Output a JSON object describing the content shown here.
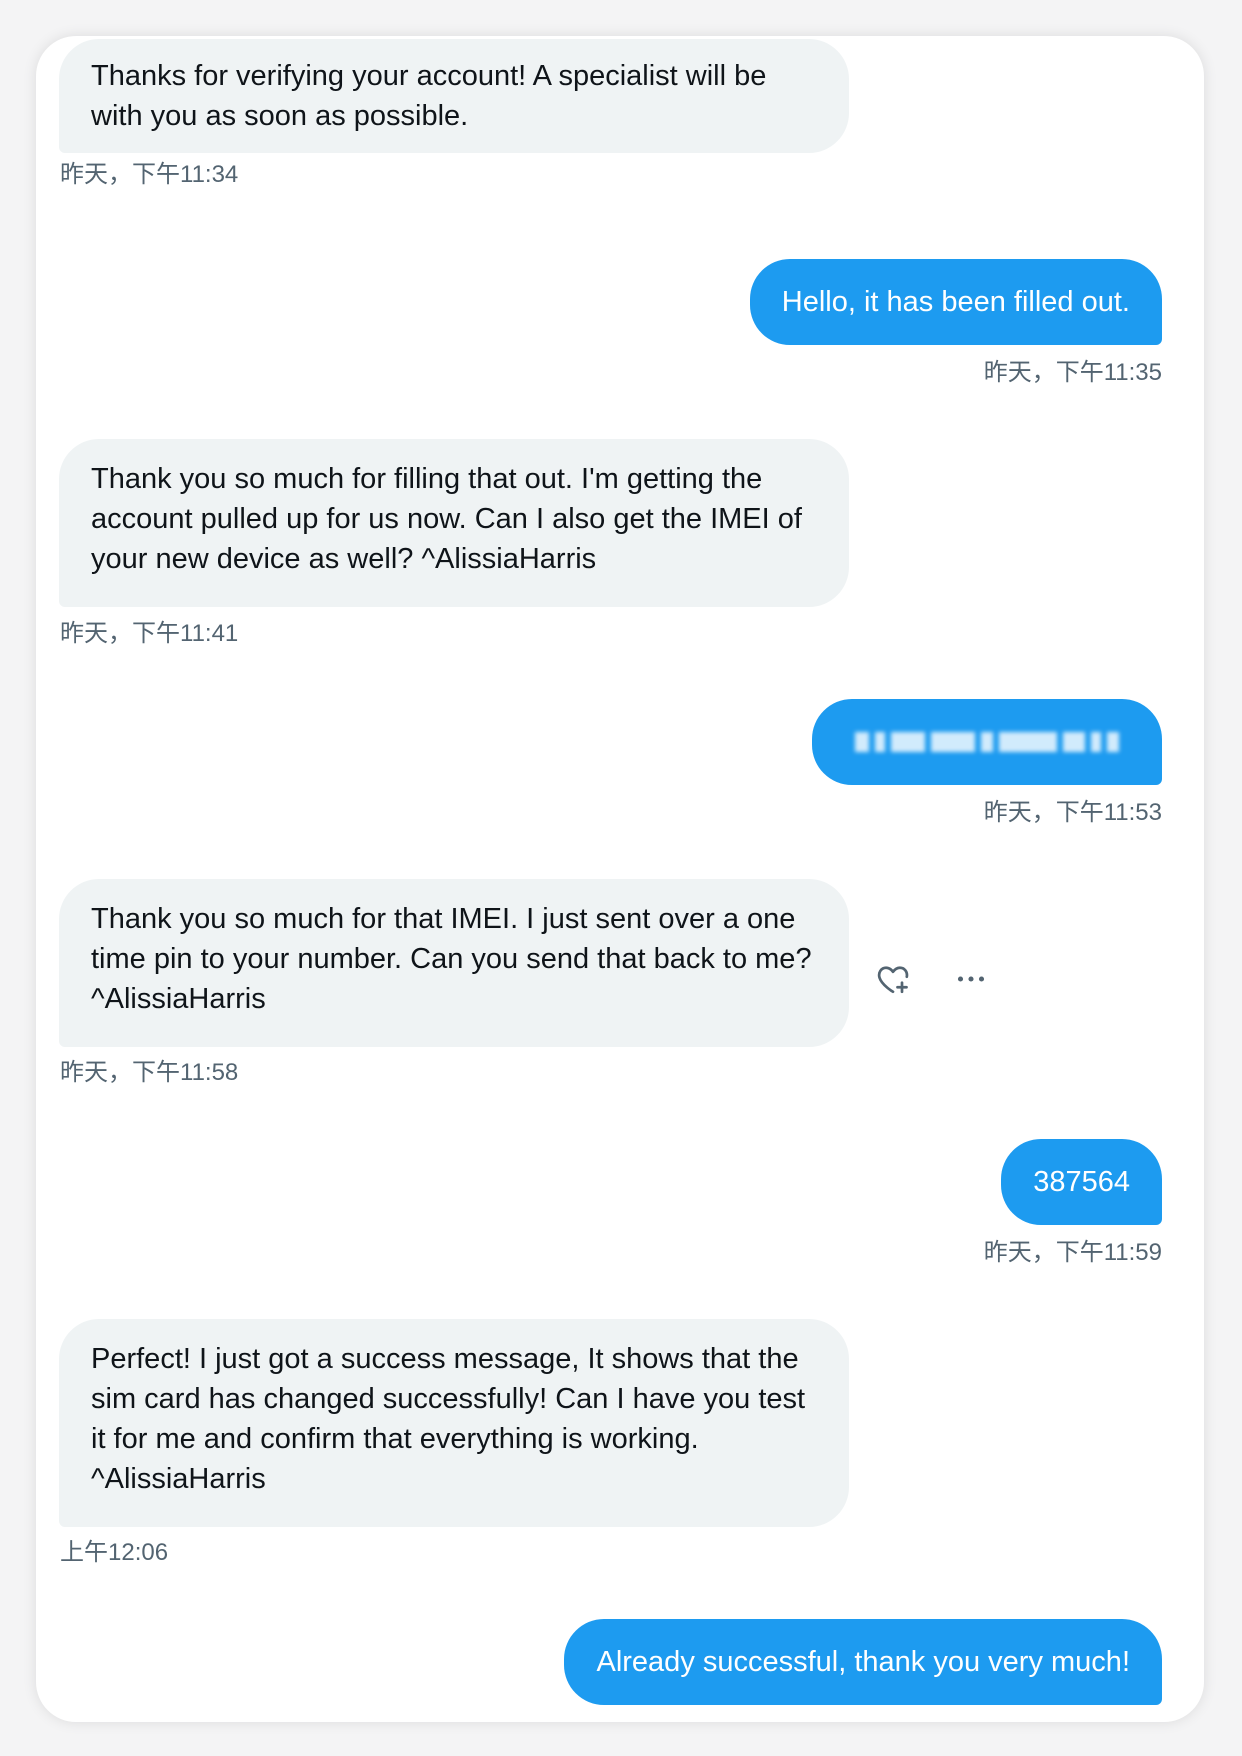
{
  "messages": [
    {
      "side": "in",
      "text": "Thanks for verifying your account! A specialist will be with you as soon as possible.",
      "time": "昨天，下午11:34"
    },
    {
      "side": "out",
      "text": "Hello, it has been filled out.",
      "time": "昨天，下午11:35"
    },
    {
      "side": "in",
      "text": "Thank you so much for filling that out. I'm getting the account pulled up for us now. Can I also get the IMEI of your new device as well? ^AlissiaHarris",
      "time": "昨天，下午11:41"
    },
    {
      "side": "out",
      "text": "",
      "time": "昨天，下午11:53",
      "redacted": true
    },
    {
      "side": "in",
      "text": "Thank you so much for that IMEI. I just sent over a one time pin to your number. Can you send that back to me? ^AlissiaHarris",
      "time": "昨天，下午11:58"
    },
    {
      "side": "out",
      "text": "387564",
      "time": "昨天，下午11:59"
    },
    {
      "side": "in",
      "text": "Perfect! I just got a success message, It shows that the sim card has changed successfully! Can I have you test it for me and confirm that everything is working. ^AlissiaHarris",
      "time": "上午12:06"
    },
    {
      "side": "out",
      "text": "Already successful, thank you very much!",
      "time": ""
    }
  ],
  "actions": {
    "react_icon": "heart-plus-icon",
    "more_icon": "more-horizontal-icon"
  },
  "colors": {
    "out_bubble": "#1d9bf0",
    "in_bubble": "#eff3f4",
    "timestamp": "#536471"
  }
}
